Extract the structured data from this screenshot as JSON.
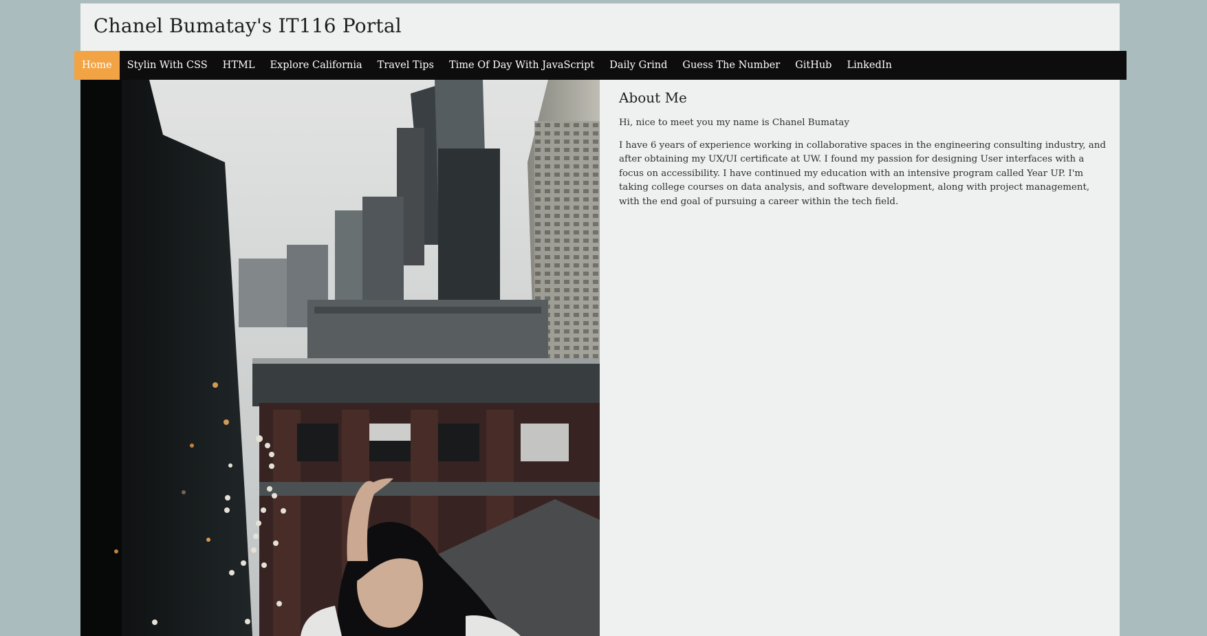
{
  "site": {
    "title": "Chanel Bumatay's IT116 Portal"
  },
  "nav": {
    "items": [
      {
        "label": "Home",
        "active": true
      },
      {
        "label": "Stylin With CSS"
      },
      {
        "label": "HTML"
      },
      {
        "label": "Explore California"
      },
      {
        "label": "Travel Tips"
      },
      {
        "label": "Time Of Day With JavaScript"
      },
      {
        "label": "Daily Grind"
      },
      {
        "label": "Guess The Number"
      },
      {
        "label": "GitHub"
      },
      {
        "label": "LinkedIn"
      }
    ]
  },
  "about": {
    "heading": "About Me",
    "intro": "Hi, nice to meet you my name is Chanel Bumatay",
    "body": "I have 6 years of experience working in collaborative spaces in the engineering consulting industry, and after obtaining my UX/UI certificate at UW. I found my passion for designing User interfaces with a focus on accessibility. I have continued my education with an intensive program called Year UP. I'm taking college courses on data analysis, and software development, along with project management, with the end goal of pursuing a career within the tech field."
  },
  "colors": {
    "page_bg": "#aabcbd",
    "content_bg": "#eff1f0",
    "nav_bg": "#0d0d0d",
    "nav_active": "#f2a444"
  },
  "photo": {
    "subject": "portrait-photo-city-rooftop"
  }
}
